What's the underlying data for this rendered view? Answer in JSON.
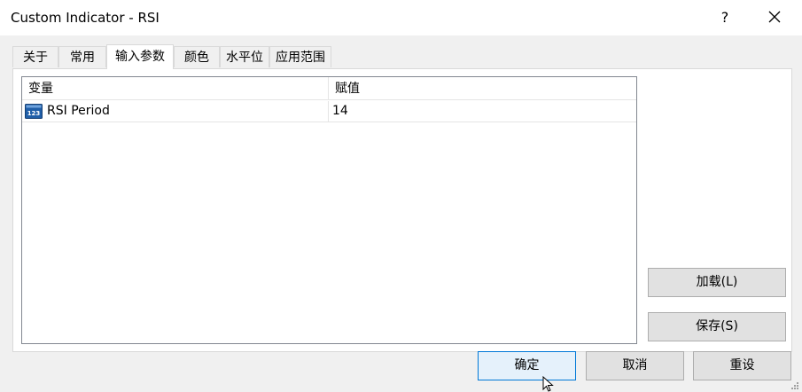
{
  "window": {
    "title": "Custom Indicator - RSI",
    "help_label": "?"
  },
  "tabs": [
    {
      "label": "关于"
    },
    {
      "label": "常用"
    },
    {
      "label": "输入参数"
    },
    {
      "label": "颜色"
    },
    {
      "label": "水平位"
    },
    {
      "label": "应用范围"
    }
  ],
  "active_tab": "输入参数",
  "params_table": {
    "columns": [
      "变量",
      "赋值"
    ],
    "rows": [
      {
        "icon": "numeric-123-icon",
        "name": "RSI Period",
        "value": "14"
      }
    ]
  },
  "side_buttons": {
    "load": "加载(L)",
    "save": "保存(S)"
  },
  "footer_buttons": {
    "ok": "确定",
    "cancel": "取消",
    "reset": "重设"
  },
  "colors": {
    "accent": "#0078d7",
    "icon_blue": "#1f5ea8"
  }
}
